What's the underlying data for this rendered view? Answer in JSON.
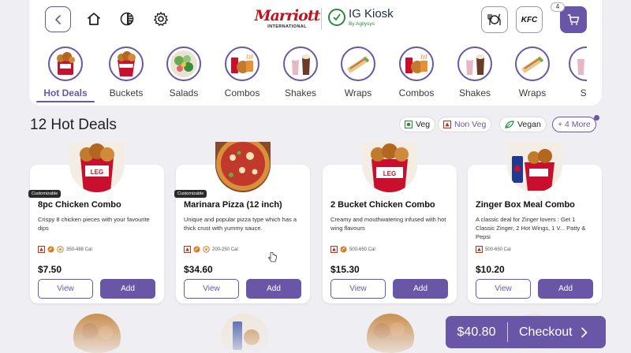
{
  "header": {
    "brand_primary": "Marriott",
    "brand_primary_sub": "INTERNATIONAL",
    "brand_secondary": "IG Kiosk",
    "brand_secondary_sub": "By Agilysys",
    "restaurant_label": "KFC",
    "cart_count": "4",
    "icons": [
      "back-icon",
      "home-icon",
      "contrast-icon",
      "gear-icon",
      "dine-in-icon",
      "cart-icon"
    ]
  },
  "categories": [
    {
      "label": "Hot Deals",
      "active": true
    },
    {
      "label": "Buckets"
    },
    {
      "label": "Salads"
    },
    {
      "label": "Combos"
    },
    {
      "label": "Shakes"
    },
    {
      "label": "Wraps"
    },
    {
      "label": "Combos"
    },
    {
      "label": "Shakes"
    },
    {
      "label": "Wraps"
    },
    {
      "label": "Sh"
    }
  ],
  "listing": {
    "title": "12 Hot Deals",
    "filters": {
      "veg": "Veg",
      "non_veg": "Non Veg",
      "vegan": "Vegan",
      "more": "+ 4 More"
    }
  },
  "products": [
    {
      "tag": "Customizable",
      "name": "8pc Chicken Combo",
      "desc": "Crispy 8 chicken pieces with your favourite dips",
      "cal": "350-488 Cal",
      "price": "$7.50",
      "view": "View",
      "add": "Add"
    },
    {
      "tag": "Customizable",
      "name": "Marinara Pizza (12 inch)",
      "desc": "Unique and popular pizza type which has a thick crust with yummy sauce.",
      "cal": "200-250 Cal",
      "price": "$34.60",
      "view": "View",
      "add": "Add"
    },
    {
      "name": "2 Bucket Chicken Combo",
      "desc": "Creamy and mouthwatering infused with hot wing flavours",
      "cal": "500-650 Cal",
      "price": "$15.30",
      "view": "View",
      "add": "Add"
    },
    {
      "name": "Zinger Box Meal Combo",
      "desc": "A classic deal for Zinger lovers : Get 1 Classic Zinger, 2 Hot Wings, 1 V... Patty & Pepsi",
      "cal": "500-650 Cal",
      "price": "$10.20",
      "view": "View",
      "add": "Add"
    }
  ],
  "checkout": {
    "amount": "$40.80",
    "label": "Checkout"
  },
  "colors": {
    "accent": "#6a56a7",
    "background": "#efeef2",
    "card": "#ffffff",
    "marriott_red": "#c0141d",
    "veg_green": "#2b8a3e",
    "nonveg_red": "#b5331f",
    "spicy_orange": "#e07a1f"
  }
}
